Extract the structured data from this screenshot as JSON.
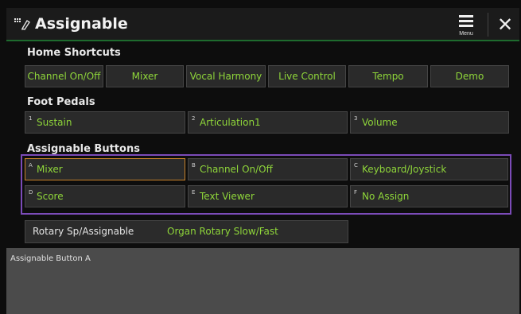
{
  "header": {
    "title": "Assignable",
    "menu_label": "Menu",
    "close_glyph": "✕",
    "accent_color": "#1e6b2e"
  },
  "home_shortcuts": {
    "label": "Home Shortcuts",
    "items": [
      "Channel On/Off",
      "Mixer",
      "Vocal Harmony",
      "Live Control",
      "Tempo",
      "Demo"
    ]
  },
  "foot_pedals": {
    "label": "Foot Pedals",
    "items": [
      {
        "index": "1",
        "label": "Sustain"
      },
      {
        "index": "2",
        "label": "Articulation1"
      },
      {
        "index": "3",
        "label": "Volume"
      }
    ]
  },
  "assignable_buttons": {
    "label": "Assignable Buttons",
    "selected": "A",
    "frame_color": "#7b4bb8",
    "items": [
      {
        "index": "A",
        "label": "Mixer"
      },
      {
        "index": "B",
        "label": "Channel On/Off"
      },
      {
        "index": "C",
        "label": "Keyboard/Joystick"
      },
      {
        "index": "D",
        "label": "Score"
      },
      {
        "index": "E",
        "label": "Text Viewer"
      },
      {
        "index": "F",
        "label": "No Assign"
      }
    ]
  },
  "rotary": {
    "label": "Rotary Sp/Assignable",
    "value": "Organ Rotary Slow/Fast"
  },
  "info_panel": {
    "text": "Assignable Button A"
  },
  "colors": {
    "value_text": "#8fd63a",
    "selected_border": "#c9822a"
  }
}
